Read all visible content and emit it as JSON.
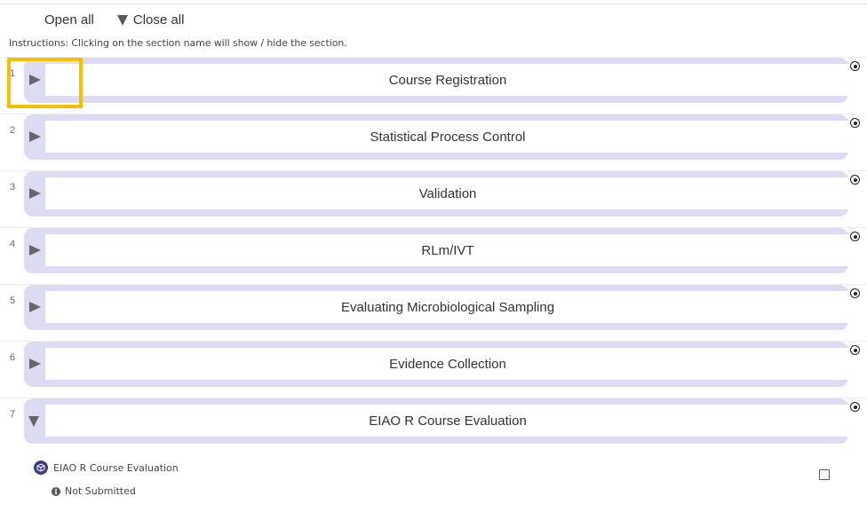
{
  "controls": {
    "open_all": "Open all",
    "close_all": "Close all"
  },
  "instructions": "Instructions: Clicking on the section name will show / hide the section.",
  "sections": [
    {
      "number": "1",
      "title": "Course Registration",
      "expanded": false
    },
    {
      "number": "2",
      "title": "Statistical Process Control",
      "expanded": false
    },
    {
      "number": "3",
      "title": "Validation",
      "expanded": false
    },
    {
      "number": "4",
      "title": "RLm/IVT",
      "expanded": false
    },
    {
      "number": "5",
      "title": "Evaluating Microbiological Sampling",
      "expanded": false
    },
    {
      "number": "6",
      "title": "Evidence Collection",
      "expanded": false
    },
    {
      "number": "7",
      "title": "EIAO R Course Evaluation",
      "expanded": true
    }
  ],
  "activity": {
    "title": "EIAO R Course Evaluation",
    "icon": "feedback-cube-icon",
    "status": "Not Submitted",
    "status_icon": "info-icon",
    "completed": false
  },
  "colors": {
    "section_bar": "#dcdbf1",
    "highlight": "#f5c000",
    "activity_icon": "#3d3a87"
  }
}
